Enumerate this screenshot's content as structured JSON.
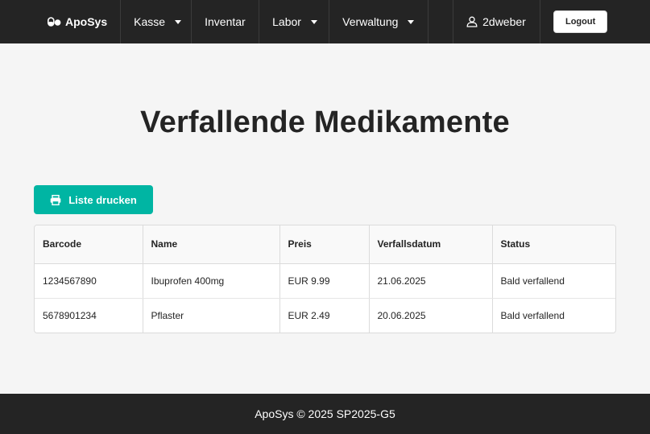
{
  "nav": {
    "brand": "ApoSys",
    "items": [
      {
        "label": "Kasse"
      },
      {
        "label": "Inventar"
      },
      {
        "label": "Labor"
      },
      {
        "label": "Verwaltung"
      }
    ],
    "user": "2dweber",
    "logout": "Logout"
  },
  "main": {
    "title": "Verfallende Medikamente",
    "print_button": "Liste drucken",
    "table": {
      "headers": [
        "Barcode",
        "Name",
        "Preis",
        "Verfallsdatum",
        "Status"
      ],
      "rows": [
        [
          "1234567890",
          "Ibuprofen 400mg",
          "EUR 9.99",
          "21.06.2025",
          "Bald verfallend"
        ],
        [
          "5678901234",
          "Pflaster",
          "EUR 2.49",
          "20.06.2025",
          "Bald verfallend"
        ]
      ]
    }
  },
  "footer": {
    "text": "ApoSys © 2025 SP2025-G5"
  },
  "colors": {
    "navbar": "#242424",
    "accent": "#00b5a3"
  },
  "icons": [
    "pills-icon",
    "user-icon",
    "printer-icon",
    "caret-down-icon"
  ]
}
